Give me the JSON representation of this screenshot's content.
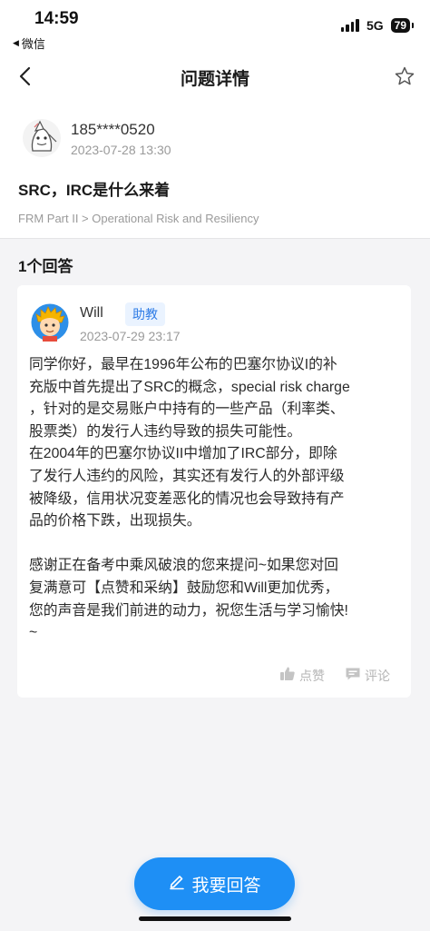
{
  "status_bar": {
    "time": "14:59",
    "back_app": "微信",
    "network": "5G",
    "battery": "79"
  },
  "nav": {
    "title": "问题详情",
    "icons": [
      "back-chevron-icon",
      "star-icon"
    ]
  },
  "question": {
    "user": "185****0520",
    "time": "2023-07-28 13:30",
    "title": "SRC，IRC是什么来着",
    "breadcrumb": "FRM Part II > Operational Risk and Resiliency"
  },
  "answers": {
    "count_label": "1个回答",
    "items": [
      {
        "user": "Will",
        "badge": "助教",
        "time": "2023-07-29 23:17",
        "lines": [
          "同学你好，最早在1996年公布的巴塞尔协议I的补",
          "充版中首先提出了SRC的概念，special risk charge",
          "，针对的是交易账户中持有的一些产品（利率类、",
          "股票类）的发行人违约导致的损失可能性。",
          "在2004年的巴塞尔协议II中增加了IRC部分，即除",
          "了发行人违约的风险，其实还有发行人的外部评级",
          "被降级，信用状况变差恶化的情况也会导致持有产",
          "品的价格下跌，出现损失。",
          "",
          "感谢正在备考中乘风破浪的您来提问~如果您对回",
          "复满意可【点赞和采纳】鼓励您和Will更加优秀，",
          "您的声音是我们前进的动力，祝您生活与学习愉快!",
          "~"
        ],
        "like_label": "点赞",
        "comment_label": "评论"
      }
    ]
  },
  "cta": {
    "label": "我要回答"
  },
  "colors": {
    "accent": "#1e8ff5",
    "badge_text": "#2f7ce6",
    "badge_bg": "#eaf3ff",
    "page_gray": "#f4f4f6"
  }
}
